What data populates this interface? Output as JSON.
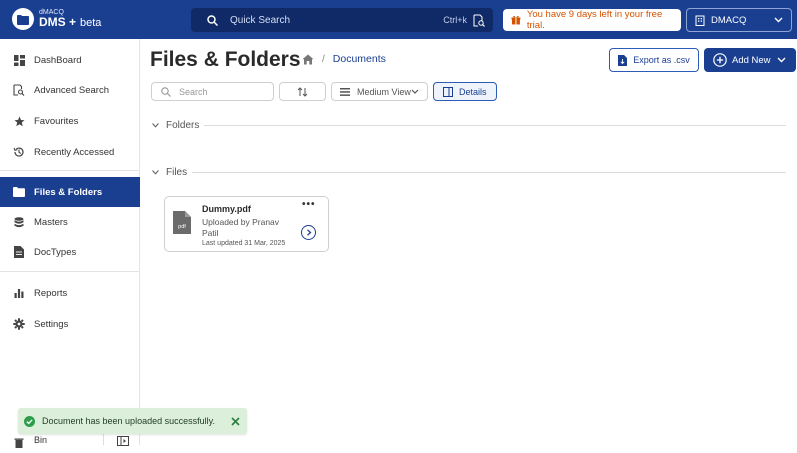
{
  "app": {
    "brand_small": "dMACQ",
    "brand_name": "DMS +",
    "brand_suffix": "beta"
  },
  "topbar": {
    "search_placeholder": "Quick Search",
    "search_shortcut": "Ctrl+k",
    "trial_notice": "You have 9 days left in your free trial.",
    "org_name": "DMACQ"
  },
  "sidebar": {
    "items": [
      {
        "label": "DashBoard",
        "icon": "dashboard-icon"
      },
      {
        "label": "Advanced Search",
        "icon": "advanced-search-icon"
      },
      {
        "label": "Favourites",
        "icon": "star-icon"
      },
      {
        "label": "Recently Accessed",
        "icon": "history-icon"
      },
      {
        "label": "Files & Folders",
        "icon": "folder-icon",
        "active": true
      },
      {
        "label": "Masters",
        "icon": "database-icon"
      },
      {
        "label": "DocTypes",
        "icon": "document-icon"
      },
      {
        "label": "Reports",
        "icon": "bar-chart-icon"
      },
      {
        "label": "Settings",
        "icon": "gear-icon"
      }
    ],
    "bin_label": "Bin"
  },
  "main": {
    "title": "Files & Folders",
    "breadcrumb_separator": "/",
    "breadcrumb_current": "Documents",
    "export_label": "Export as .csv",
    "add_new_label": "Add New",
    "search_placeholder": "Search",
    "view_label": "Medium View",
    "details_label": "Details",
    "folders_heading": "Folders",
    "files_heading": "Files"
  },
  "files": [
    {
      "name": "Dummy.pdf",
      "type_badge": "pdf",
      "uploaded_by": "Uploaded by Pranav Patil",
      "last_updated": "Last updated 31 Mar, 2025",
      "menu": "•••"
    }
  ],
  "toast": {
    "message": "Document has been uploaded successfully."
  },
  "colors": {
    "primary": "#1a3f91",
    "trial_text": "#d35400",
    "toast_bg": "#dcefdb",
    "toast_icon": "#2e9d4a"
  }
}
